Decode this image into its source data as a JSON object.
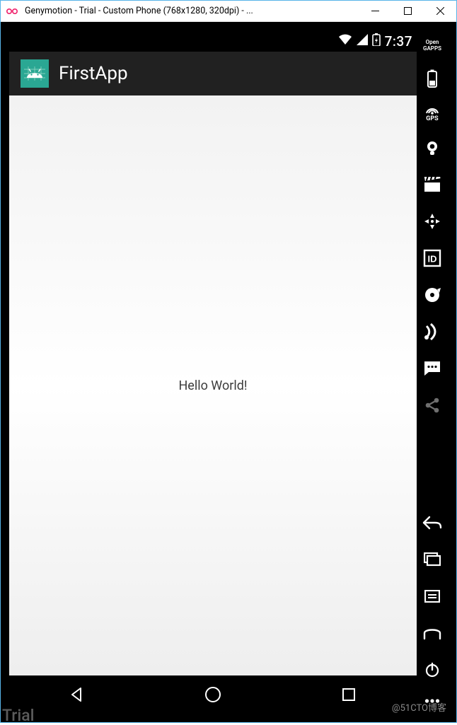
{
  "window": {
    "title": "Genymotion - Trial - Custom Phone (768x1280, 320dpi) - ..."
  },
  "status_bar": {
    "clock": "7:37"
  },
  "action_bar": {
    "title": "FirstApp"
  },
  "content": {
    "hello": "Hello World!"
  },
  "side": {
    "gapps_line1": "Open",
    "gapps_line2": "GAPPS",
    "gps_label": "GPS",
    "id_label": "ID"
  },
  "watermark": {
    "trial": "Trial",
    "cto": "@51CTO博客"
  }
}
